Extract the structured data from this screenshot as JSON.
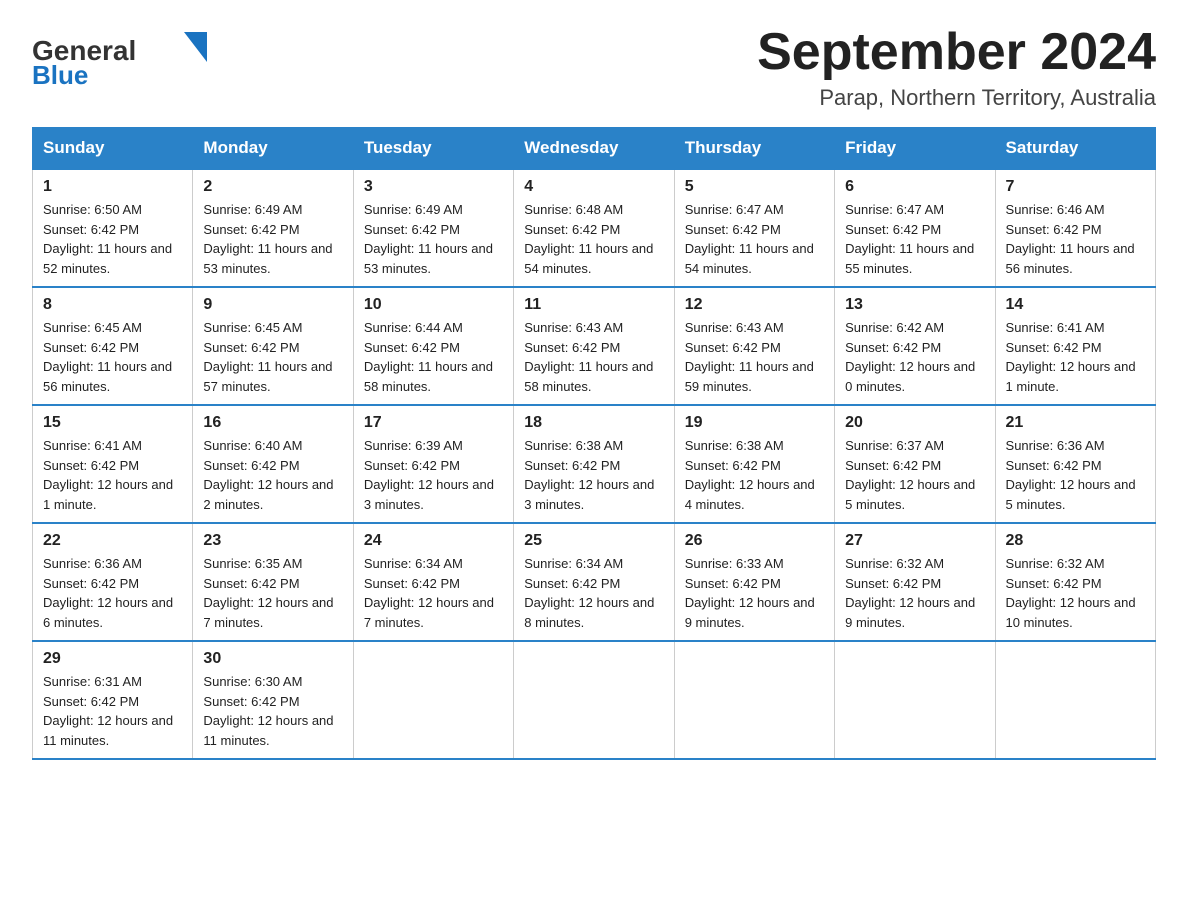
{
  "header": {
    "logo_general": "General",
    "logo_blue": "Blue",
    "title": "September 2024",
    "subtitle": "Parap, Northern Territory, Australia"
  },
  "days_of_week": [
    "Sunday",
    "Monday",
    "Tuesday",
    "Wednesday",
    "Thursday",
    "Friday",
    "Saturday"
  ],
  "weeks": [
    [
      {
        "day": "1",
        "sunrise": "6:50 AM",
        "sunset": "6:42 PM",
        "daylight": "11 hours and 52 minutes."
      },
      {
        "day": "2",
        "sunrise": "6:49 AM",
        "sunset": "6:42 PM",
        "daylight": "11 hours and 53 minutes."
      },
      {
        "day": "3",
        "sunrise": "6:49 AM",
        "sunset": "6:42 PM",
        "daylight": "11 hours and 53 minutes."
      },
      {
        "day": "4",
        "sunrise": "6:48 AM",
        "sunset": "6:42 PM",
        "daylight": "11 hours and 54 minutes."
      },
      {
        "day": "5",
        "sunrise": "6:47 AM",
        "sunset": "6:42 PM",
        "daylight": "11 hours and 54 minutes."
      },
      {
        "day": "6",
        "sunrise": "6:47 AM",
        "sunset": "6:42 PM",
        "daylight": "11 hours and 55 minutes."
      },
      {
        "day": "7",
        "sunrise": "6:46 AM",
        "sunset": "6:42 PM",
        "daylight": "11 hours and 56 minutes."
      }
    ],
    [
      {
        "day": "8",
        "sunrise": "6:45 AM",
        "sunset": "6:42 PM",
        "daylight": "11 hours and 56 minutes."
      },
      {
        "day": "9",
        "sunrise": "6:45 AM",
        "sunset": "6:42 PM",
        "daylight": "11 hours and 57 minutes."
      },
      {
        "day": "10",
        "sunrise": "6:44 AM",
        "sunset": "6:42 PM",
        "daylight": "11 hours and 58 minutes."
      },
      {
        "day": "11",
        "sunrise": "6:43 AM",
        "sunset": "6:42 PM",
        "daylight": "11 hours and 58 minutes."
      },
      {
        "day": "12",
        "sunrise": "6:43 AM",
        "sunset": "6:42 PM",
        "daylight": "11 hours and 59 minutes."
      },
      {
        "day": "13",
        "sunrise": "6:42 AM",
        "sunset": "6:42 PM",
        "daylight": "12 hours and 0 minutes."
      },
      {
        "day": "14",
        "sunrise": "6:41 AM",
        "sunset": "6:42 PM",
        "daylight": "12 hours and 1 minute."
      }
    ],
    [
      {
        "day": "15",
        "sunrise": "6:41 AM",
        "sunset": "6:42 PM",
        "daylight": "12 hours and 1 minute."
      },
      {
        "day": "16",
        "sunrise": "6:40 AM",
        "sunset": "6:42 PM",
        "daylight": "12 hours and 2 minutes."
      },
      {
        "day": "17",
        "sunrise": "6:39 AM",
        "sunset": "6:42 PM",
        "daylight": "12 hours and 3 minutes."
      },
      {
        "day": "18",
        "sunrise": "6:38 AM",
        "sunset": "6:42 PM",
        "daylight": "12 hours and 3 minutes."
      },
      {
        "day": "19",
        "sunrise": "6:38 AM",
        "sunset": "6:42 PM",
        "daylight": "12 hours and 4 minutes."
      },
      {
        "day": "20",
        "sunrise": "6:37 AM",
        "sunset": "6:42 PM",
        "daylight": "12 hours and 5 minutes."
      },
      {
        "day": "21",
        "sunrise": "6:36 AM",
        "sunset": "6:42 PM",
        "daylight": "12 hours and 5 minutes."
      }
    ],
    [
      {
        "day": "22",
        "sunrise": "6:36 AM",
        "sunset": "6:42 PM",
        "daylight": "12 hours and 6 minutes."
      },
      {
        "day": "23",
        "sunrise": "6:35 AM",
        "sunset": "6:42 PM",
        "daylight": "12 hours and 7 minutes."
      },
      {
        "day": "24",
        "sunrise": "6:34 AM",
        "sunset": "6:42 PM",
        "daylight": "12 hours and 7 minutes."
      },
      {
        "day": "25",
        "sunrise": "6:34 AM",
        "sunset": "6:42 PM",
        "daylight": "12 hours and 8 minutes."
      },
      {
        "day": "26",
        "sunrise": "6:33 AM",
        "sunset": "6:42 PM",
        "daylight": "12 hours and 9 minutes."
      },
      {
        "day": "27",
        "sunrise": "6:32 AM",
        "sunset": "6:42 PM",
        "daylight": "12 hours and 9 minutes."
      },
      {
        "day": "28",
        "sunrise": "6:32 AM",
        "sunset": "6:42 PM",
        "daylight": "12 hours and 10 minutes."
      }
    ],
    [
      {
        "day": "29",
        "sunrise": "6:31 AM",
        "sunset": "6:42 PM",
        "daylight": "12 hours and 11 minutes."
      },
      {
        "day": "30",
        "sunrise": "6:30 AM",
        "sunset": "6:42 PM",
        "daylight": "12 hours and 11 minutes."
      },
      null,
      null,
      null,
      null,
      null
    ]
  ],
  "labels": {
    "sunrise": "Sunrise:",
    "sunset": "Sunset:",
    "daylight": "Daylight:"
  }
}
